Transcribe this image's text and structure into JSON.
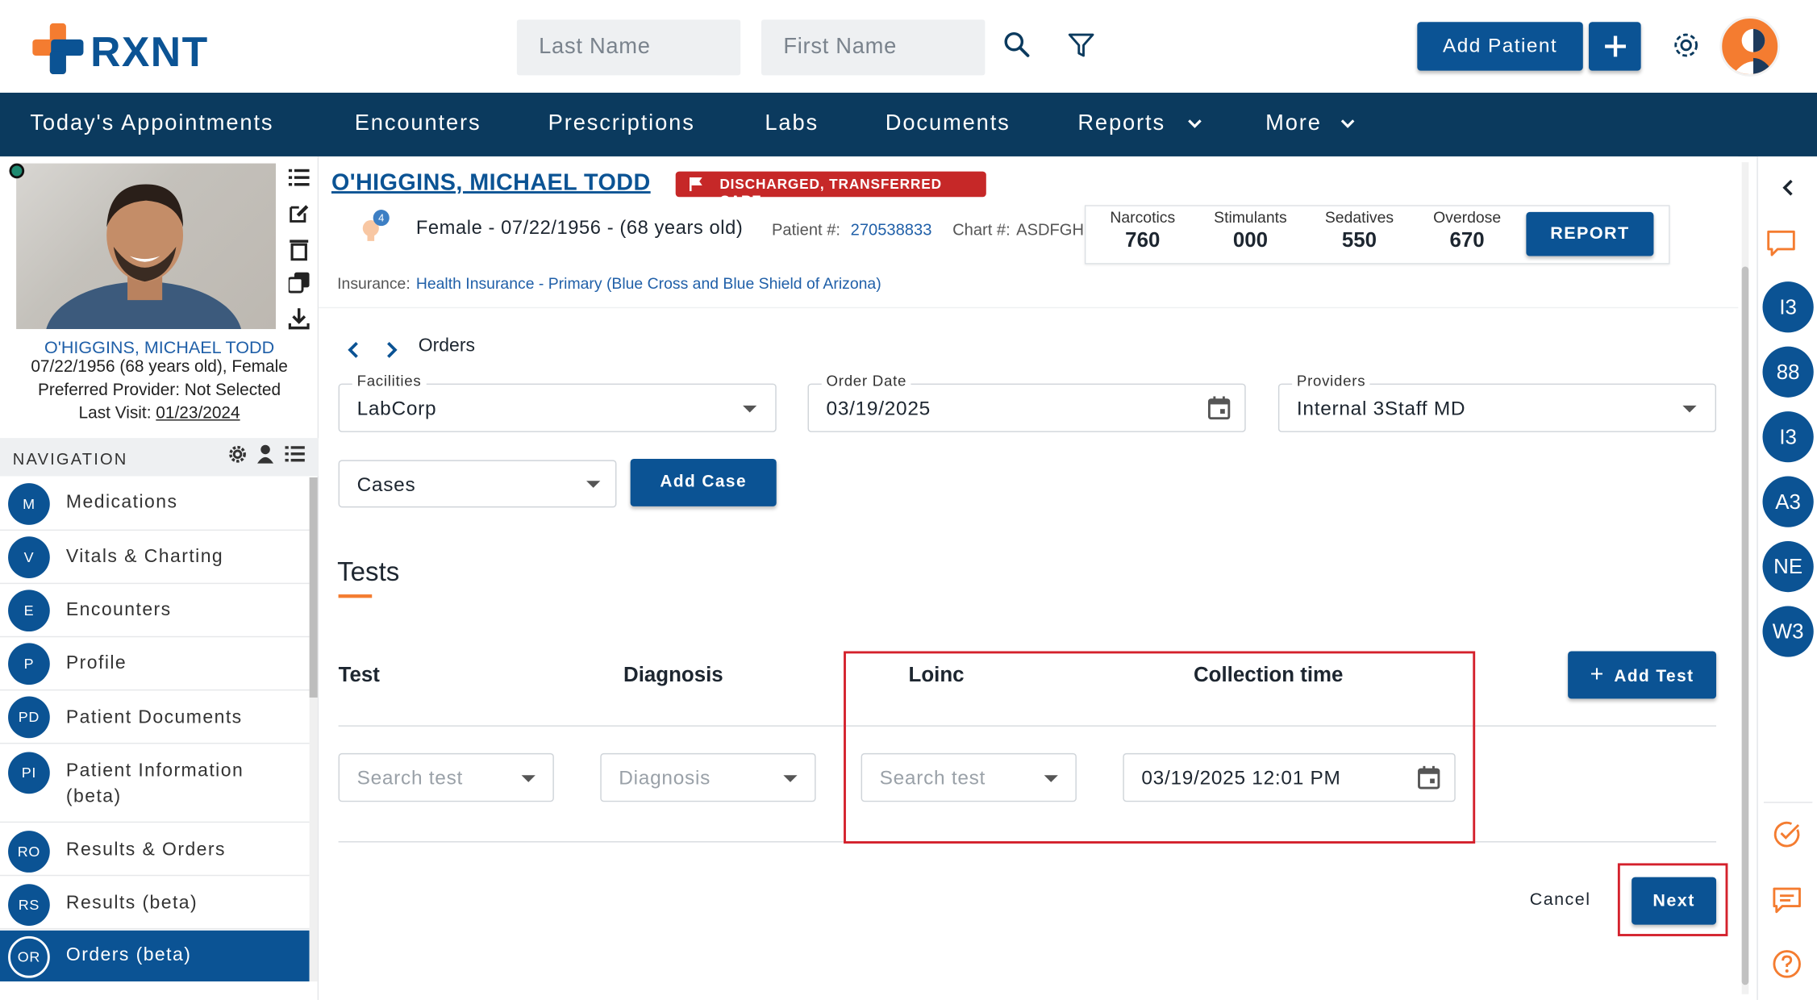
{
  "brand": {
    "name": "RXNT"
  },
  "header": {
    "last_name_placeholder": "Last Name",
    "first_name_placeholder": "First Name",
    "add_patient_label": "Add Patient",
    "add_icon": "plus-icon",
    "search_icon": "search-icon",
    "filter_icon": "filter-icon",
    "settings_icon": "gear-icon",
    "avatar_icon": "user-avatar-icon"
  },
  "nav": {
    "items": [
      {
        "label": "Today's Appointments"
      },
      {
        "label": "Encounters"
      },
      {
        "label": "Prescriptions"
      },
      {
        "label": "Labs"
      },
      {
        "label": "Documents"
      },
      {
        "label": "Reports"
      },
      {
        "label": "More"
      }
    ]
  },
  "patient": {
    "name_link": "O'HIGGINS, MICHAEL TODD",
    "status_badge": "DISCHARGED, TRANSFERRED CARE",
    "demographics": "Female - 07/22/1956 - (68 years old)",
    "patient_no_label": "Patient #:",
    "patient_no": "270538833",
    "chart_no_label": "Chart #:",
    "chart_no": "ASDFGH",
    "alert_count": "4",
    "insurance_label": "Insurance:",
    "insurance": "Health Insurance - Primary (Blue Cross and Blue Shield of Arizona)",
    "card_name": "O'HIGGINS, MICHAEL TODD",
    "card_dob": "07/22/1956 (68 years old), Female",
    "card_provider": "Preferred Provider: Not Selected",
    "card_last_visit_label": "Last Visit:",
    "card_last_visit": "01/23/2024"
  },
  "risk_scores": {
    "items": [
      {
        "label": "Narcotics",
        "value": "760"
      },
      {
        "label": "Stimulants",
        "value": "000"
      },
      {
        "label": "Sedatives",
        "value": "550"
      },
      {
        "label": "Overdose",
        "value": "670"
      }
    ],
    "report_label": "REPORT"
  },
  "sidebar": {
    "header": "NAVIGATION",
    "items": [
      {
        "badge": "M",
        "label": "Medications"
      },
      {
        "badge": "V",
        "label": "Vitals & Charting"
      },
      {
        "badge": "E",
        "label": "Encounters"
      },
      {
        "badge": "P",
        "label": "Profile"
      },
      {
        "badge": "PD",
        "label": "Patient Documents"
      },
      {
        "badge": "PI",
        "label": "Patient Information",
        "label2": "(beta)"
      },
      {
        "badge": "RO",
        "label": "Results & Orders"
      },
      {
        "badge": "RS",
        "label": "Results (beta)"
      },
      {
        "badge": "OR",
        "label": "Orders (beta)",
        "active": true
      }
    ]
  },
  "orders": {
    "breadcrumb": "Orders",
    "facilities_label": "Facilities",
    "facilities_value": "LabCorp",
    "order_date_label": "Order Date",
    "order_date_value": "03/19/2025",
    "providers_label": "Providers",
    "providers_value": "Internal 3Staff MD",
    "cases_value": "Cases",
    "add_case_label": "Add Case",
    "tests_heading": "Tests",
    "columns": [
      "Test",
      "Diagnosis",
      "Loinc",
      "Collection time"
    ],
    "add_test_label": "Add Test",
    "row": {
      "test_placeholder": "Search test",
      "diagnosis_placeholder": "Diagnosis",
      "loinc_placeholder": "Search test",
      "collection_time": "03/19/2025 12:01 PM"
    },
    "cancel_label": "Cancel",
    "next_label": "Next"
  },
  "rail": {
    "items": [
      "I3",
      "88",
      "I3",
      "A3",
      "NE",
      "W3"
    ]
  },
  "colors": {
    "brand_blue": "#0b5394",
    "navbar": "#0b3a5e",
    "badge_red": "#c62828",
    "accent_orange": "#f47c30",
    "highlight_red": "#d4212c"
  }
}
